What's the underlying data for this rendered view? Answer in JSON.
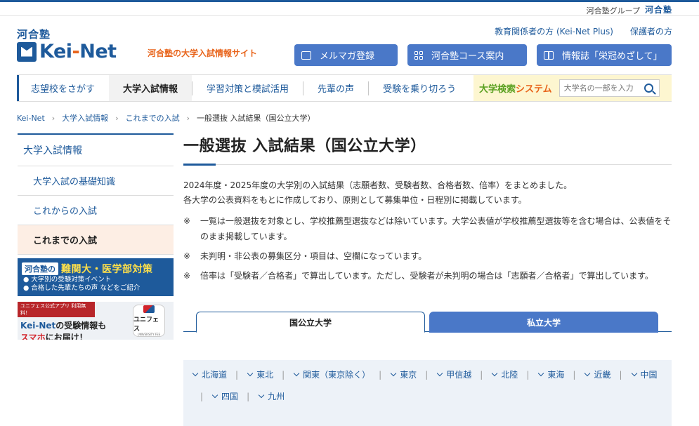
{
  "top_bar": {
    "group_text": "河合塾グループ",
    "group_logo": "河合塾"
  },
  "header": {
    "brand_kana": "河合塾",
    "brand_pre": "Kei",
    "brand_dash": "-",
    "brand_post": "Net",
    "tagline": "河合塾の大学入試情報サイト",
    "util_links": [
      "教育関係者の方 (Kei-Net Plus)",
      "保護者の方"
    ],
    "buttons": [
      {
        "label": "メルマガ登録",
        "icon": "mail-icon"
      },
      {
        "label": "河合塾コース案内",
        "icon": "grid-icon"
      },
      {
        "label": "情報誌「栄冠めざして」",
        "icon": "book-icon"
      }
    ]
  },
  "nav": {
    "items": [
      "志望校をさがす",
      "大学入試情報",
      "学習対策と模試活用",
      "先輩の声",
      "受験を乗り切ろう"
    ],
    "active_index": 1,
    "search_title_a": "大学検索",
    "search_title_b": "システム",
    "search_placeholder": "大学名の一部を入力"
  },
  "breadcrumb": [
    "Kei-Net",
    "大学入試情報",
    "これまでの入試",
    "一般選抜 入試結果（国公立大学）"
  ],
  "sidebar": {
    "head": "大学入試情報",
    "items": [
      "大学入試の基礎知識",
      "これからの入試",
      "これまでの入試"
    ],
    "active_index": 2
  },
  "banners": {
    "b1_pill": "河合塾の",
    "b1_big": "難関大・医学部対策",
    "b1_line1": "● 大学別の受験対策イベント",
    "b1_line2": "● 合格した先輩たちの声 などをご紹介",
    "b2_strip": "ユニフェス公式アプリ 利用無料！",
    "b2_l1a": "Kei-Net",
    "b2_l1b": "の受験情報も",
    "b2_l2a": "スマホ",
    "b2_l2b": "にお届け！",
    "app_name": "ユニフェス",
    "app_sub": "UNIVERSITY FES"
  },
  "main": {
    "title": "一般選抜 入試結果（国公立大学）",
    "intro1": "2024年度・2025年度の大学別の入試結果（志願者数、受験者数、合格者数、倍率）をまとめました。",
    "intro2": "各大学の公表資料をもとに作成しており、原則として募集単位・日程別に掲載しています。",
    "note_mark": "※",
    "notes": [
      "一覧は一般選抜を対象とし、学校推薦型選抜などは除いています。大学公表値が学校推薦型選抜等を含む場合は、公表値をそのまま掲載しています。",
      "未判明・非公表の募集区分・項目は、空欄になっています。",
      "倍率は「受験者／合格者」で算出しています。ただし、受験者が未判明の場合は「志願者／合格者」で算出しています。"
    ]
  },
  "tabs": {
    "national": "国公立大学",
    "private": "私立大学"
  },
  "regions": [
    "北海道",
    "東北",
    "関東（東京除く）",
    "東京",
    "甲信越",
    "北陸",
    "東海",
    "近畿",
    "中国",
    "四国",
    "九州"
  ]
}
